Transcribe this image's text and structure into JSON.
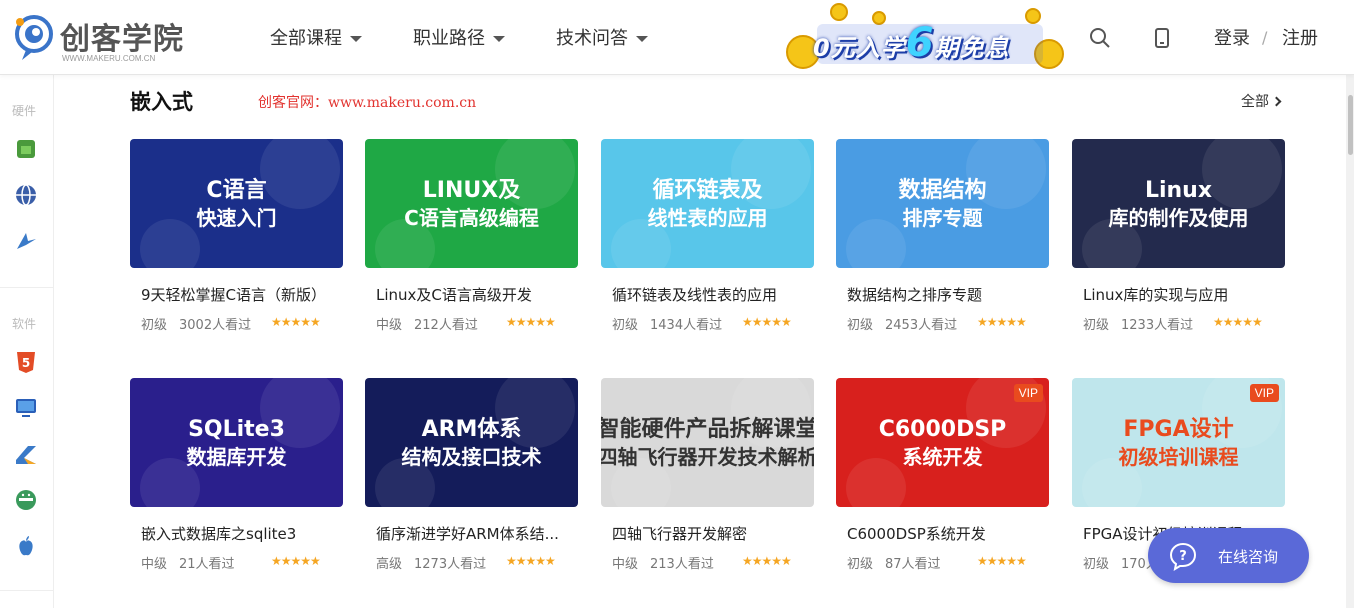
{
  "header": {
    "logo_text": "创客学院",
    "logo_sub": "WWW.MAKERU.COM.CN",
    "nav": [
      {
        "label": "全部课程"
      },
      {
        "label": "职业路径"
      },
      {
        "label": "技术问答"
      }
    ],
    "banner_text_a": "0元入学",
    "banner_text_b": "6",
    "banner_text_c": "期免息",
    "login_label": "登录",
    "separator": "/",
    "register_label": "注册",
    "icons": [
      "search-icon",
      "mobile-icon"
    ]
  },
  "sidebar": {
    "hardware_label": "硬件",
    "software_label": "软件",
    "hardware_icons": [
      "chip-icon",
      "globe-icon",
      "drone-icon"
    ],
    "software_icons": [
      "html5-icon",
      "monitor-icon",
      "kotlin-icon",
      "android-icon",
      "apple-icon"
    ]
  },
  "section": {
    "title": "嵌入式",
    "site_text": "创客官网：www.makeru.com.cn",
    "all_label": "全部"
  },
  "courses": [
    {
      "thumb_l1": "C语言",
      "thumb_l2": "快速入门",
      "title": "9天轻松掌握C语言（新版）",
      "level": "初级",
      "views": "3002人看过",
      "stars": "★★★★★",
      "bg": "#1b2f8a",
      "vip": ""
    },
    {
      "thumb_l1": "LINUX及",
      "thumb_l2": "C语言高级编程",
      "title": "Linux及C语言高级开发",
      "level": "中级",
      "views": "212人看过",
      "stars": "★★★★★",
      "bg": "#1fa845",
      "vip": ""
    },
    {
      "thumb_l1": "循环链表及",
      "thumb_l2": "线性表的应用",
      "title": "循环链表及线性表的应用",
      "level": "初级",
      "views": "1434人看过",
      "stars": "★★★★★",
      "bg": "#58c6ea",
      "vip": ""
    },
    {
      "thumb_l1": "数据结构",
      "thumb_l2": "排序专题",
      "title": "数据结构之排序专题",
      "level": "初级",
      "views": "2453人看过",
      "stars": "★★★★★",
      "bg": "#4a9ce3",
      "vip": ""
    },
    {
      "thumb_l1": "Linux",
      "thumb_l2": "库的制作及使用",
      "title": "Linux库的实现与应用",
      "level": "初级",
      "views": "1233人看过",
      "stars": "★★★★★",
      "bg": "#232a4d",
      "vip": ""
    },
    {
      "thumb_l1": "SQLite3",
      "thumb_l2": "数据库开发",
      "title": "嵌入式数据库之sqlite3",
      "level": "中级",
      "views": "21人看过",
      "stars": "★★★★★",
      "bg": "#2a1f8c",
      "vip": ""
    },
    {
      "thumb_l1": "ARM体系",
      "thumb_l2": "结构及接口技术",
      "title": "循序渐进学好ARM体系结...",
      "level": "高级",
      "views": "1273人看过",
      "stars": "★★★★★",
      "bg": "#141c5a",
      "vip": ""
    },
    {
      "thumb_l1": "智能硬件产品拆解课堂",
      "thumb_l2": "四轴飞行器开发技术解析",
      "title": "四轴飞行器开发解密",
      "level": "中级",
      "views": "213人看过",
      "stars": "★★★★★",
      "bg": "#d9d9d9",
      "vip": ""
    },
    {
      "thumb_l1": "C6000DSP",
      "thumb_l2": "系统开发",
      "title": "C6000DSP系统开发",
      "level": "初级",
      "views": "87人看过",
      "stars": "★★★★★",
      "bg": "#d8201d",
      "vip": "VIP"
    },
    {
      "thumb_l1": "FPGA设计",
      "thumb_l2": "初级培训课程",
      "title": "FPGA设计初级培训课程",
      "level": "初级",
      "views": "170人看过",
      "stars": "★★★★★",
      "bg": "#bfe6ec",
      "vip": "VIP"
    }
  ],
  "consult": {
    "label": "在线咨询"
  },
  "colors": {
    "accent": "#5a69d8",
    "site_text": "#e2332f",
    "vip": "#e94b1e",
    "stars": "#f5a623"
  }
}
